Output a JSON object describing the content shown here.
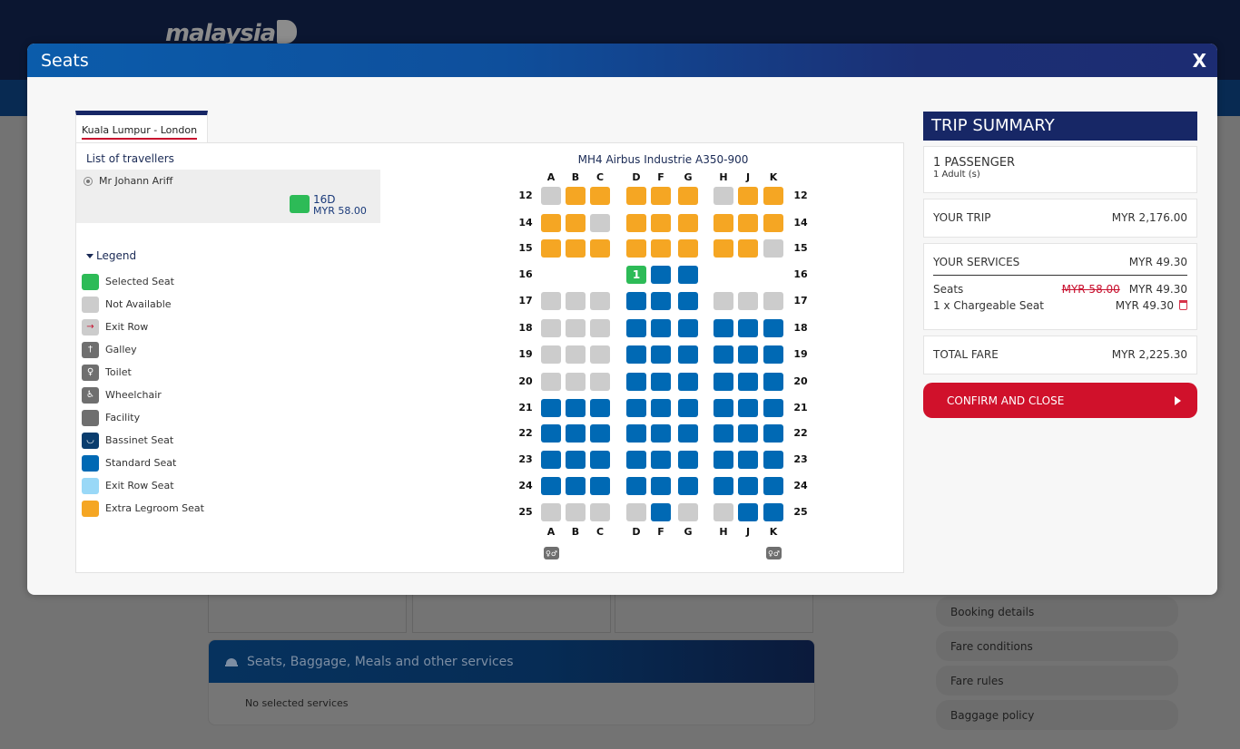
{
  "background": {
    "logo_text": "malaysia",
    "services_header": "Seats, Baggage, Meals and other services",
    "services_empty": "No selected services",
    "links": [
      "Booking details",
      "Fare conditions",
      "Fare rules",
      "Baggage policy"
    ]
  },
  "modal": {
    "title": "Seats",
    "close_label": "X",
    "tab_label": "Kuala Lumpur - London",
    "travellers_title": "List of travellers",
    "traveller": {
      "name": "Mr Johann Ariff",
      "seat": "16D",
      "price": "MYR 58.00"
    },
    "legend_title": "Legend",
    "legend": [
      {
        "key": "selected",
        "label": "Selected Seat",
        "color": "#2dbb57",
        "icon": ""
      },
      {
        "key": "unavailable",
        "label": "Not Available",
        "color": "#cccccc",
        "icon": ""
      },
      {
        "key": "exit-row",
        "label": "Exit Row",
        "color": "#cccccc",
        "icon": "exit-icon"
      },
      {
        "key": "galley",
        "label": "Galley",
        "color": "#6f6f6f",
        "icon": "galley-icon"
      },
      {
        "key": "toilet",
        "label": "Toilet",
        "color": "#6f6f6f",
        "icon": "toilet-icon"
      },
      {
        "key": "wheelchair",
        "label": "Wheelchair",
        "color": "#6f6f6f",
        "icon": "wheelchair-icon"
      },
      {
        "key": "facility",
        "label": "Facility",
        "color": "#6f6f6f",
        "icon": ""
      },
      {
        "key": "bassinet",
        "label": "Bassinet Seat",
        "color": "#0a3d6e",
        "icon": "bassinet-icon"
      },
      {
        "key": "standard",
        "label": "Standard Seat",
        "color": "#0069b4",
        "icon": ""
      },
      {
        "key": "exit-row-seat",
        "label": "Exit Row Seat",
        "color": "#99d8f7",
        "icon": ""
      },
      {
        "key": "extra-legroom",
        "label": "Extra Legroom Seat",
        "color": "#f5a623",
        "icon": ""
      }
    ],
    "seatmap": {
      "aircraft": "MH4 Airbus Industrie A350-900",
      "columns": [
        "A",
        "B",
        "C",
        "D",
        "F",
        "G",
        "H",
        "J",
        "K"
      ],
      "selected_marker": "1",
      "rows": [
        {
          "row": "12",
          "seats": [
            "U",
            "L",
            "L",
            "L",
            "L",
            "L",
            "U",
            "L",
            "L"
          ]
        },
        {
          "row": "14",
          "seats": [
            "L",
            "L",
            "U",
            "L",
            "L",
            "L",
            "L",
            "L",
            "L"
          ]
        },
        {
          "row": "15",
          "seats": [
            "L",
            "L",
            "L",
            "L",
            "L",
            "L",
            "L",
            "L",
            "U"
          ]
        },
        {
          "row": "16",
          "seats": [
            "-",
            "-",
            "-",
            "S",
            "A",
            "A",
            "-",
            "-",
            "-"
          ]
        },
        {
          "row": "17",
          "seats": [
            "U",
            "U",
            "U",
            "A",
            "A",
            "A",
            "U",
            "U",
            "U"
          ]
        },
        {
          "row": "18",
          "seats": [
            "U",
            "U",
            "U",
            "A",
            "A",
            "A",
            "A",
            "A",
            "A"
          ]
        },
        {
          "row": "19",
          "seats": [
            "U",
            "U",
            "U",
            "A",
            "A",
            "A",
            "A",
            "A",
            "A"
          ]
        },
        {
          "row": "20",
          "seats": [
            "U",
            "U",
            "U",
            "A",
            "A",
            "A",
            "A",
            "A",
            "A"
          ]
        },
        {
          "row": "21",
          "seats": [
            "A",
            "A",
            "A",
            "A",
            "A",
            "A",
            "A",
            "A",
            "A"
          ]
        },
        {
          "row": "22",
          "seats": [
            "A",
            "A",
            "A",
            "A",
            "A",
            "A",
            "A",
            "A",
            "A"
          ]
        },
        {
          "row": "23",
          "seats": [
            "A",
            "A",
            "A",
            "A",
            "A",
            "A",
            "A",
            "A",
            "A"
          ]
        },
        {
          "row": "24",
          "seats": [
            "A",
            "A",
            "A",
            "A",
            "A",
            "A",
            "A",
            "A",
            "A"
          ]
        },
        {
          "row": "25",
          "seats": [
            "U",
            "U",
            "U",
            "U",
            "A",
            "U",
            "U",
            "A",
            "A"
          ]
        }
      ],
      "seat_colors": {
        "U": "#cccccc",
        "L": "#f5a623",
        "A": "#0069b4",
        "S": "#2dbb57"
      },
      "facilities_after": [
        {
          "column": "A",
          "type": "toilet"
        },
        {
          "column": "K",
          "type": "toilet"
        }
      ]
    }
  },
  "summary": {
    "title": "TRIP SUMMARY",
    "passengers": "1 PASSENGER",
    "passenger_detail": "1 Adult (s)",
    "your_trip_label": "YOUR TRIP",
    "your_trip_value": "MYR 2,176.00",
    "services_label": "YOUR SERVICES",
    "services_value": "MYR 49.30",
    "seats_label": "Seats",
    "seats_original": "MYR 58.00",
    "seats_value": "MYR 49.30",
    "item_label": "1 x Chargeable Seat",
    "item_value": "MYR 49.30",
    "total_label": "TOTAL FARE",
    "total_value": "MYR 2,225.30",
    "confirm_label": "CONFIRM AND CLOSE"
  }
}
